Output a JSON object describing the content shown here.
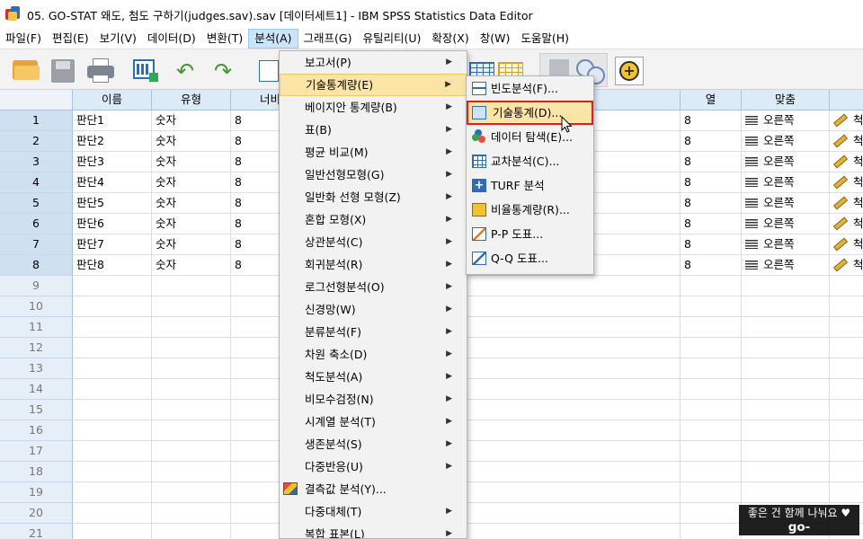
{
  "window": {
    "title": "05. GO-STAT 왜도, 첨도 구하기(judges.sav).sav [데이터세트1] - IBM SPSS Statistics Data Editor"
  },
  "menubar": [
    "파일(F)",
    "편집(E)",
    "보기(V)",
    "데이터(D)",
    "변환(T)",
    "분석(A)",
    "그래프(G)",
    "유틸리티(U)",
    "확장(X)",
    "창(W)",
    "도움말(H)"
  ],
  "active_menu": "분석(A)",
  "toolbar": {
    "icons": [
      "open-folder-icon",
      "save-icon",
      "print-icon",
      "dialog-recall-icon",
      "undo-icon",
      "redo-icon",
      "chart-icon",
      "variables-grid-icon",
      "value-labels-grid-icon",
      "venn-sets-icon",
      "spell-check-icon"
    ]
  },
  "grid": {
    "headers": [
      "이름",
      "유형",
      "너비",
      "열",
      "맞춤",
      "측도"
    ],
    "rows": [
      {
        "num": "1",
        "name": "판단1",
        "type": "숫자",
        "width": "8",
        "columns": "8",
        "align": "오른쪽",
        "measure": "척도"
      },
      {
        "num": "2",
        "name": "판단2",
        "type": "숫자",
        "width": "8",
        "columns": "8",
        "align": "오른쪽",
        "measure": "척도"
      },
      {
        "num": "3",
        "name": "판단3",
        "type": "숫자",
        "width": "8",
        "columns": "8",
        "align": "오른쪽",
        "measure": "척도"
      },
      {
        "num": "4",
        "name": "판단4",
        "type": "숫자",
        "width": "8",
        "columns": "8",
        "align": "오른쪽",
        "measure": "척도"
      },
      {
        "num": "5",
        "name": "판단5",
        "type": "숫자",
        "width": "8",
        "columns": "8",
        "align": "오른쪽",
        "measure": "척도"
      },
      {
        "num": "6",
        "name": "판단6",
        "type": "숫자",
        "width": "8",
        "columns": "8",
        "align": "오른쪽",
        "measure": "척도"
      },
      {
        "num": "7",
        "name": "판단7",
        "type": "숫자",
        "width": "8",
        "columns": "8",
        "align": "오른쪽",
        "measure": "척도"
      },
      {
        "num": "8",
        "name": "판단8",
        "type": "숫자",
        "width": "8",
        "columns": "8",
        "align": "오른쪽",
        "measure": "척도"
      }
    ],
    "empty_rows": [
      "9",
      "10",
      "11",
      "12",
      "13",
      "14",
      "15",
      "16",
      "17",
      "18",
      "19",
      "20",
      "21"
    ]
  },
  "analysis_menu": {
    "items": [
      {
        "label": "보고서(P)",
        "submenu": true
      },
      {
        "label": "기술통계량(E)",
        "submenu": true,
        "highlighted": true
      },
      {
        "label": "베이지안 통계량(B)",
        "submenu": true
      },
      {
        "label": "표(B)",
        "submenu": true
      },
      {
        "label": "평균 비교(M)",
        "submenu": true
      },
      {
        "label": "일반선형모형(G)",
        "submenu": true
      },
      {
        "label": "일반화 선형 모형(Z)",
        "submenu": true
      },
      {
        "label": "혼합 모형(X)",
        "submenu": true
      },
      {
        "label": "상관분석(C)",
        "submenu": true
      },
      {
        "label": "회귀분석(R)",
        "submenu": true
      },
      {
        "label": "로그선형분석(O)",
        "submenu": true
      },
      {
        "label": "신경망(W)",
        "submenu": true
      },
      {
        "label": "분류분석(F)",
        "submenu": true
      },
      {
        "label": "차원 축소(D)",
        "submenu": true
      },
      {
        "label": "척도분석(A)",
        "submenu": true
      },
      {
        "label": "비모수검정(N)",
        "submenu": true
      },
      {
        "label": "시계열 분석(T)",
        "submenu": true
      },
      {
        "label": "생존분석(S)",
        "submenu": true
      },
      {
        "label": "다중반응(U)",
        "submenu": true
      },
      {
        "label": "결측값 분석(Y)...",
        "submenu": false,
        "icon": "missing-value-icon"
      },
      {
        "label": "다중대체(T)",
        "submenu": true
      },
      {
        "label": "복합 표본(L)",
        "submenu": true
      }
    ]
  },
  "descriptives_submenu": {
    "items": [
      {
        "label": "빈도분석(F)...",
        "icon": "frequencies-icon"
      },
      {
        "label": "기술통계(D)...",
        "icon": "descriptives-icon",
        "selected": true
      },
      {
        "label": "데이터 탐색(E)...",
        "icon": "explore-icon"
      },
      {
        "label": "교차분석(C)...",
        "icon": "crosstabs-icon"
      },
      {
        "label": "TURF 분석",
        "icon": "turf-icon"
      },
      {
        "label": "비율통계량(R)...",
        "icon": "ratio-icon"
      },
      {
        "label": "P-P 도표...",
        "icon": "pp-plot-icon"
      },
      {
        "label": "Q-Q 도표...",
        "icon": "qq-plot-icon"
      }
    ]
  },
  "watermark": {
    "line1": "좋은 건 함께 나눠요 ♥",
    "line2": "go-stat.tistory.com"
  },
  "colors": {
    "menu_highlight": "#fbe5a6",
    "selection_border": "#e0201b",
    "header_bg": "#ddebf7"
  }
}
